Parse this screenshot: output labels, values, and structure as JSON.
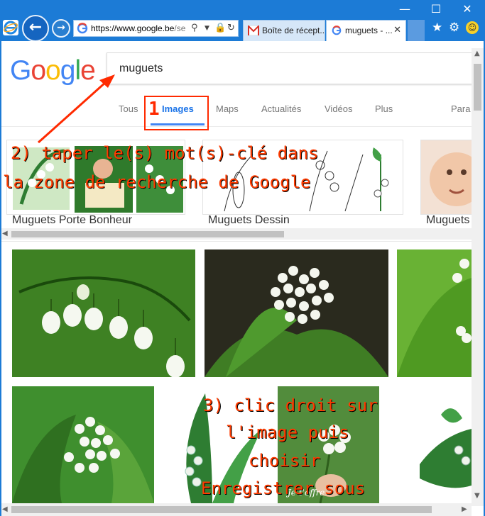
{
  "browser": {
    "address_host": "https://www.google.be",
    "address_rest": "/se",
    "tabs": [
      {
        "label": "Boîte de récept..."
      },
      {
        "label": "muguets - ...",
        "active": true
      }
    ]
  },
  "google": {
    "logo_text": "Google",
    "search_query": "muguets",
    "tabs": [
      "Tous",
      "Images",
      "Maps",
      "Actualités",
      "Vidéos",
      "Plus",
      "Para"
    ],
    "active_tab": "Images"
  },
  "related": [
    {
      "label": "Muguets Porte Bonheur"
    },
    {
      "label": "Muguets Dessin"
    },
    {
      "label": "Muguets"
    }
  ],
  "annotations": {
    "step1_number": "1",
    "step2_line1": "2) taper le(s) mot(s)-clé dans",
    "step2_line2": "la zone de recherche de Google",
    "step3_line1": "3) clic droit sur",
    "step3_line2": "l'image puis",
    "step3_line3": "choisir",
    "step3_line4": "Enregistrer sous"
  },
  "image_caption": "Je t'offre",
  "colors": {
    "chrome_blue": "#1c7bd6",
    "annotation_red": "#ff3b00",
    "google_blue": "#4285f4"
  }
}
